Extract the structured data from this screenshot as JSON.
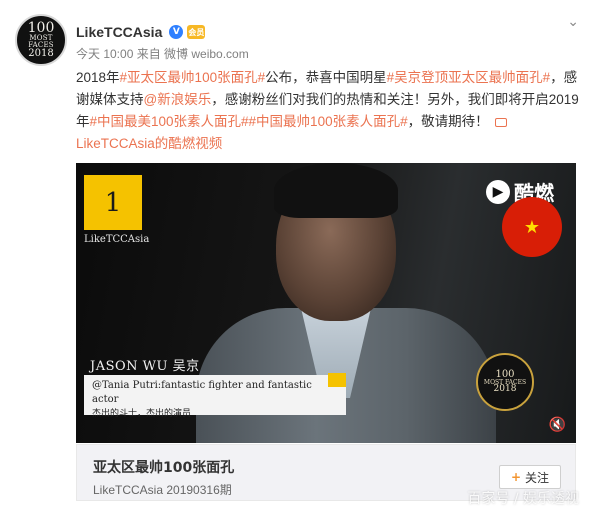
{
  "post": {
    "avatar": {
      "line1": "100",
      "line2": "MOST",
      "line3": "FACES",
      "line4": "2018"
    },
    "username": "LikeTCCAsia",
    "verified_mark": "V",
    "vip_badge": "会员",
    "meta": "今天 10:00 来自 微博 weibo.com",
    "content": {
      "t1": "2018年",
      "tag1": "#亚太区最帅100张面孔#",
      "t2": "公布，恭喜中国明星",
      "tag2": "#吴京登顶亚太区最帅面孔#",
      "t3": "，感谢媒体支持",
      "mention": "@新浪娱乐",
      "t4": "，感谢粉丝们对我们的热情和关注！另外，我们即将开启2019年",
      "tag3": "#中国最美100张素人面孔#",
      "tag4": "#中国最帅100张素人面孔#",
      "t5": "，敬请期待！",
      "video_link": "LikeTCCAsia的酷燃视频"
    }
  },
  "video": {
    "rank": "1",
    "rank_sub": "LikeTCCAsia",
    "logo_text": "酷燃",
    "name_title": "JASON WU  吴京",
    "quote_en": "@Tania Putri:fantastic fighter and fantastic actor",
    "quote_cn": "杰出的斗士，杰出的演员",
    "badge": {
      "line1": "100",
      "line2": "MOST FACES",
      "line3": "2018"
    }
  },
  "card": {
    "title": "亚太区最帅100张面孔",
    "subtitle": "LikeTCCAsia 20190316期",
    "follow_label": "关注"
  },
  "watermark": "百家号 / 娱乐透视",
  "colors": {
    "link": "#eb7350",
    "verified": "#2f80ff",
    "rank_yellow": "#f5c200"
  },
  "icons": [
    "chevron-down-icon",
    "verified-icon",
    "video-link-icon",
    "mute-icon",
    "plus-icon"
  ]
}
